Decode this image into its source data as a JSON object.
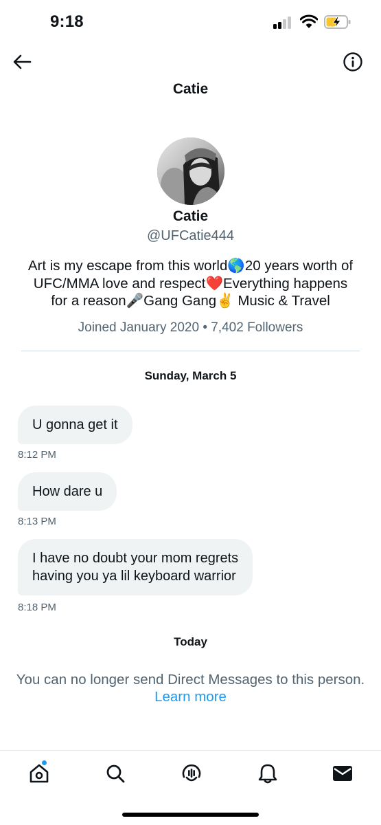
{
  "status_bar": {
    "time": "9:18"
  },
  "header": {
    "title": "Catie"
  },
  "profile": {
    "name": "Catie",
    "handle": "@UFCatie444",
    "bio_lines": [
      "Art is my escape from this world🌎20 years worth of",
      "UFC/MMA love and respect❤️Everything happens",
      "for a reason🎤Gang Gang✌️ Music & Travel"
    ],
    "meta": "Joined January 2020 • 7,402 Followers"
  },
  "conversation": {
    "date_label": "Sunday, March 5",
    "messages": [
      {
        "text": "U gonna get it",
        "time": "8:12 PM"
      },
      {
        "text": "How dare u",
        "time": "8:13 PM"
      },
      {
        "lines": [
          "I have no doubt your mom regrets",
          "having you ya lil keyboard warrior"
        ],
        "time": "8:18 PM"
      }
    ],
    "today_label": "Today",
    "notice": "You can no longer send Direct Messages to this person.",
    "learn_more": "Learn more"
  },
  "tabbar": {
    "icons": [
      "home-icon",
      "search-icon",
      "spaces-icon",
      "notifications-icon",
      "messages-icon"
    ],
    "accent": "#1d9bf0"
  },
  "colors": {
    "bubble": "#eff3f4",
    "secondary_text": "#536471",
    "link": "#1d9bf0"
  }
}
